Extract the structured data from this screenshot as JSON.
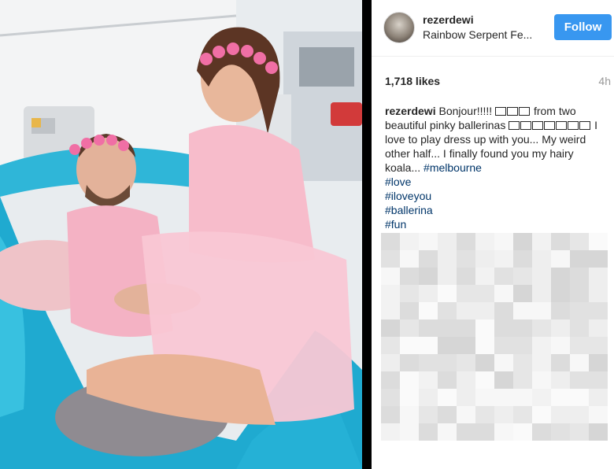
{
  "post": {
    "username": "rezerdewi",
    "location": "Rainbow Serpent Fe...",
    "follow_label": "Follow",
    "likes": "1,718 likes",
    "time": "4h"
  },
  "caption": {
    "user": "rezerdewi",
    "line1": "Bonjour!!!!!",
    "line2": "from two beautiful pinky ballerinas",
    "line3": "I love to play dress up with you...",
    "line4": "My weird other half... I finally found you my hairy koala...",
    "mention": "#melbourne",
    "tags": [
      "#love",
      "#iloveyou",
      "#ballerina",
      "#fun"
    ]
  },
  "colors": {
    "follow_button": "#3897f0",
    "hashtag": "#003569",
    "pool_blue": "#2bb3d6",
    "tutu_pink": "#f6b8c6"
  },
  "icons": {
    "avatar": "profile-photo"
  }
}
